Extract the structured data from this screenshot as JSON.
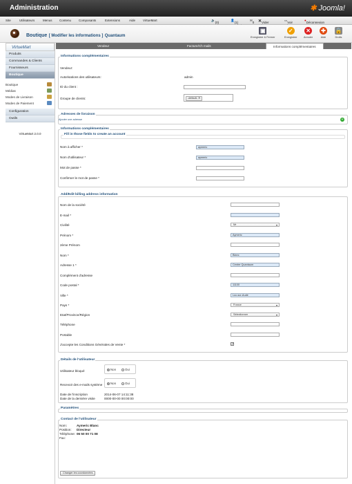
{
  "header": {
    "title": "Administration",
    "logo": "Joomla!"
  },
  "menu": {
    "items": [
      "Site",
      "Utilisateurs",
      "Menus",
      "Contenu",
      "Composants",
      "Extensions",
      "Aide",
      "VirtueMart"
    ],
    "status": [
      "(0) Site",
      "(1) Admin",
      "0",
      "Vider le cache",
      "Voir le site",
      "Déconnexion"
    ]
  },
  "toolbar": {
    "title": "Boutique",
    "subtitle": "[ Modifier les informations ]",
    "name": "Quantaum",
    "buttons": [
      "Enregistrer & Fermer",
      "Enregistrer",
      "Annuler",
      "Aide",
      "Droits"
    ]
  },
  "sidebar": {
    "logo": "VirtueMart",
    "top_items": [
      "Produits",
      "Commandes & Clients",
      "Fournisseurs",
      "Boutique"
    ],
    "sub_items": [
      "Boutique",
      "Médias",
      "Modes de Livraison",
      "Modes de Paiement"
    ],
    "bottom_items": [
      "Configuration",
      "Outils"
    ],
    "version": "VirtueMart 2.0.0"
  },
  "tabs": [
    "Vendeur",
    "Facture/Ch mails",
    "Informations complémentaires"
  ],
  "info": {
    "legend": "Informations complémentaires",
    "vendeur": "Vendeur:",
    "auth_label": "Autorisations des utilisateurs:",
    "auth_value": "admin",
    "id_label": "ID du client :",
    "group_label": "Groupe de clients:",
    "group_value": "-default-"
  },
  "delivery": {
    "legend": "Adresses de livraison",
    "add_link": "Ajouter une adresse"
  },
  "account": {
    "legend": "Informations complémentaires",
    "sub_legend": "Fill in those fields to create an account",
    "fields": [
      {
        "label": "Nom à afficher *",
        "value": "aymeric"
      },
      {
        "label": "Nom d'utilisateur *",
        "value": "aymeric"
      },
      {
        "label": "Mot de passe *",
        "value": ""
      },
      {
        "label": "Confirmer le mot de passe *",
        "value": ""
      }
    ]
  },
  "billing": {
    "legend": "Add/Edit billing address information",
    "fields": [
      {
        "label": "Nom de la société",
        "value": ""
      },
      {
        "label": "E-mail *",
        "value": ""
      },
      {
        "label": "Civilité",
        "value": "Mr"
      },
      {
        "label": "Prénom *",
        "value": "Aymeric"
      },
      {
        "label": "2ème Prénom",
        "value": ""
      },
      {
        "label": "Nom *",
        "value": "Blanc"
      },
      {
        "label": "Adresse 1 *",
        "value": "Centre Quantaum"
      },
      {
        "label": "Complément d'adresse",
        "value": ""
      },
      {
        "label": "Code postal *",
        "value": "11100"
      },
      {
        "label": "Ville *",
        "value": "Luc-sur-Aude"
      },
      {
        "label": "Pays *",
        "value": "France"
      },
      {
        "label": "Etat/Province/Région",
        "value": "Sélectionner"
      },
      {
        "label": "Téléphone",
        "value": ""
      },
      {
        "label": "Portable",
        "value": ""
      },
      {
        "label": "J'accepte les Conditions Générales de Vente *",
        "value": ""
      }
    ]
  },
  "user": {
    "legend": "Détails de l'utilisateur",
    "blocked": "Utilisateur bloqué",
    "emails": "Recevoir des e-mails système",
    "non": "Non",
    "oui": "Oui",
    "reg_label": "Date de l'inscription",
    "reg_value": "2014-06-07 14:11:38",
    "visit_label": "Date de la dernière visite",
    "visit_value": "0000-00-00 00:00:00"
  },
  "params": {
    "legend": "Paramètres"
  },
  "contact": {
    "legend": "Contact de l'utilisateur",
    "rows": [
      [
        "Nom:",
        "Aymeric Blanc"
      ],
      [
        "Position:",
        "Directeur"
      ],
      [
        "Téléphone:",
        "06 50 00 71 08"
      ],
      [
        "Fax:",
        ""
      ]
    ],
    "button": "Changer les coordonnées"
  }
}
